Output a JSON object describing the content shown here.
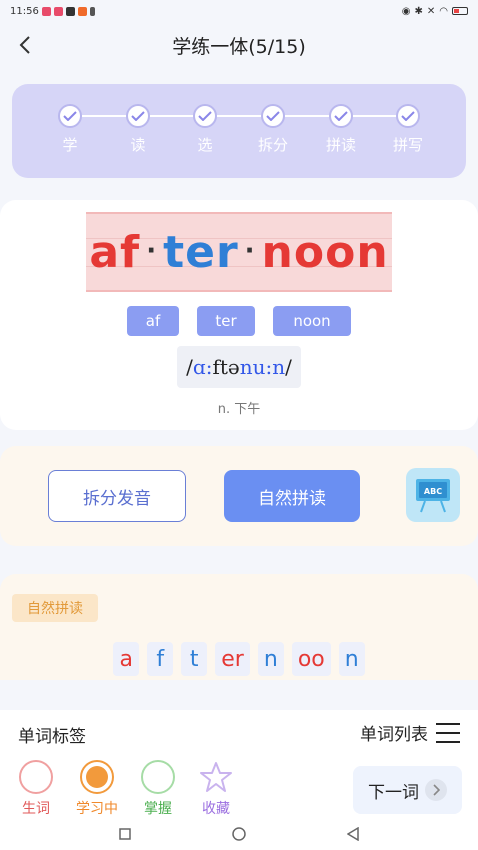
{
  "status_bar": {
    "time": "11:56"
  },
  "nav": {
    "title": "学练一体(5/15)",
    "back_icon": "chevron-left-icon"
  },
  "steps": [
    {
      "label": "学",
      "done": true
    },
    {
      "label": "读",
      "done": true
    },
    {
      "label": "选",
      "done": true
    },
    {
      "label": "拆分",
      "done": true
    },
    {
      "label": "拼读",
      "done": true
    },
    {
      "label": "拼写",
      "done": true
    }
  ],
  "word": {
    "syllables": [
      "af",
      "ter",
      "noon"
    ],
    "syllable_colors": [
      "#e53935",
      "#2f7fd6",
      "#e53935"
    ],
    "separator": "·",
    "phonetic_prefix": "/",
    "phonetic_a": "ɑ:",
    "phonetic_b": "ftə",
    "phonetic_c": "nu:n",
    "phonetic_suffix": "/",
    "meaning": "n. 下午"
  },
  "actions": {
    "split_label": "拆分发音",
    "phonics_label": "自然拼读",
    "board_icon": "abc-board-icon",
    "board_text": "ABC"
  },
  "phonics": {
    "tag": "自然拼读",
    "letters": [
      {
        "text": "a",
        "color": "#e53935"
      },
      {
        "text": "f",
        "color": "#2f7fd6"
      },
      {
        "text": "t",
        "color": "#2f7fd6"
      },
      {
        "text": "er",
        "color": "#e53935"
      },
      {
        "text": "n",
        "color": "#2f7fd6"
      },
      {
        "text": "oo",
        "color": "#e53935"
      },
      {
        "text": "n",
        "color": "#2f7fd6"
      }
    ]
  },
  "bottom": {
    "tags_title": "单词标签",
    "list_label": "单词列表",
    "tags": [
      {
        "label": "生词",
        "color": "#f0a0a0",
        "text_color": "#e05a5a",
        "selected": false
      },
      {
        "label": "学习中",
        "color": "#f29a3c",
        "text_color": "#f08a2c",
        "selected": true
      },
      {
        "label": "掌握",
        "color": "#a6dca6",
        "text_color": "#4caf50",
        "selected": false
      },
      {
        "label": "收藏",
        "color": "#c9b3ee",
        "text_color": "#9b6fe0",
        "selected": false
      }
    ],
    "next_label": "下一词",
    "next_icon": "chevron-right-icon"
  },
  "system_nav": [
    "square-icon",
    "circle-icon",
    "triangle-back-icon"
  ]
}
